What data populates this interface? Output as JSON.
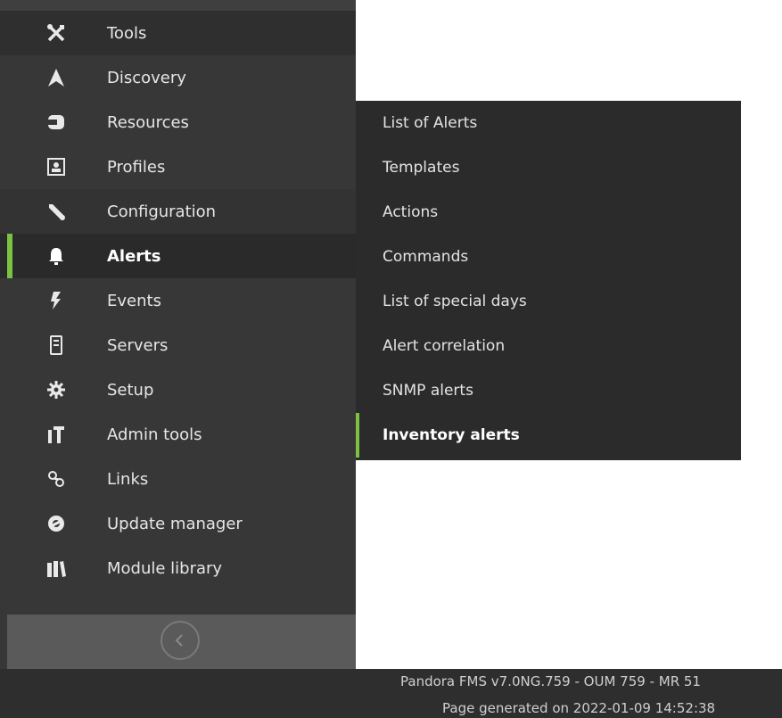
{
  "sidebar": {
    "items": [
      {
        "label": "Tools",
        "icon": "tools-icon"
      },
      {
        "label": "Discovery",
        "icon": "discovery-icon"
      },
      {
        "label": "Resources",
        "icon": "resources-icon"
      },
      {
        "label": "Profiles",
        "icon": "profiles-icon"
      },
      {
        "label": "Configuration",
        "icon": "wrench-icon"
      },
      {
        "label": "Alerts",
        "icon": "bell-icon"
      },
      {
        "label": "Events",
        "icon": "lightning-icon"
      },
      {
        "label": "Servers",
        "icon": "server-icon"
      },
      {
        "label": "Setup",
        "icon": "gear-icon"
      },
      {
        "label": "Admin tools",
        "icon": "admin-tools-icon"
      },
      {
        "label": "Links",
        "icon": "link-icon"
      },
      {
        "label": "Update manager",
        "icon": "update-icon"
      },
      {
        "label": "Module library",
        "icon": "library-icon"
      }
    ],
    "active_item": "Alerts",
    "collapse_icon": "chevron-left-circle-icon"
  },
  "submenu": {
    "items": [
      {
        "label": "List of Alerts"
      },
      {
        "label": "Templates"
      },
      {
        "label": "Actions"
      },
      {
        "label": "Commands"
      },
      {
        "label": "List of special days"
      },
      {
        "label": "Alert correlation"
      },
      {
        "label": "SNMP alerts"
      },
      {
        "label": "Inventory alerts"
      }
    ],
    "active_item": "Inventory alerts"
  },
  "footer": {
    "version": "Pandora FMS v7.0NG.759 - OUM 759 - MR 51",
    "generated": "Page generated on 2022-01-09 14:52:38"
  },
  "colors": {
    "accent": "#7cc242",
    "sidebar_bg": "#373737",
    "submenu_bg": "#2b2b2b"
  }
}
